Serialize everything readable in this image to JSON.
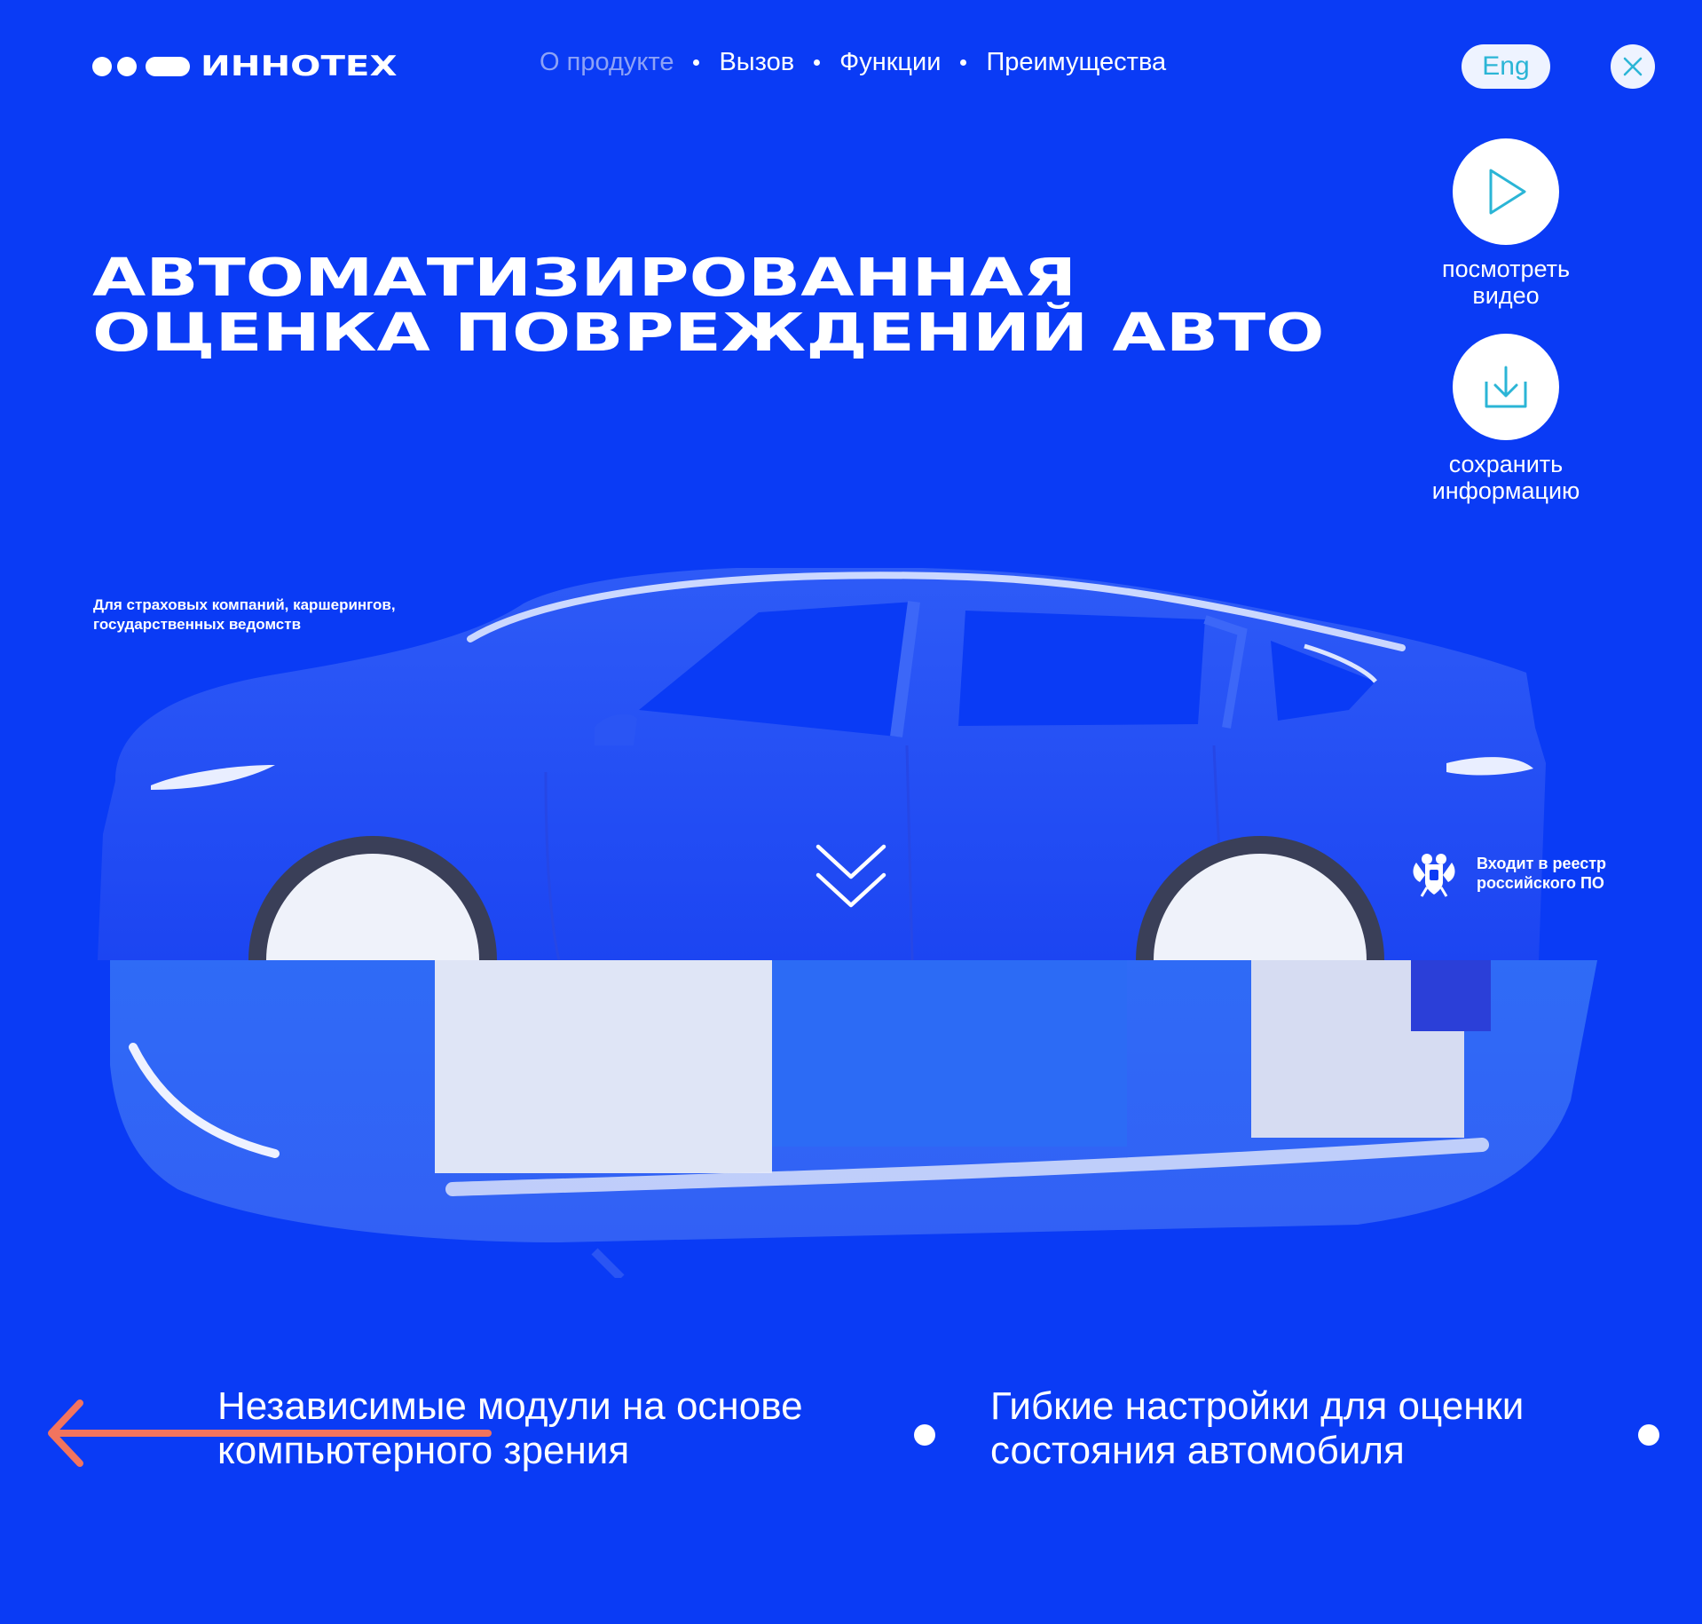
{
  "header": {
    "logo_text": "ИННОТЕХ",
    "nav": [
      {
        "label": "О продукте",
        "active": true
      },
      {
        "label": "Вызов",
        "active": false
      },
      {
        "label": "Функции",
        "active": false
      },
      {
        "label": "Преимущества",
        "active": false
      }
    ],
    "lang_label": "Eng"
  },
  "actions": {
    "video": {
      "line1": "посмотреть",
      "line2": "видео"
    },
    "save": {
      "line1": "сохранить",
      "line2": "информацию"
    }
  },
  "hero": {
    "title_line1": "АВТОМАТИЗИРОВАННАЯ",
    "title_line2": "ОЦЕНКА ПОВРЕЖДЕНИЙ АВТО",
    "audience_line1": "Для страховых компаний, каршерингов,",
    "audience_line2": "государственных ведомств"
  },
  "registry": {
    "line1": "Входит в реестр",
    "line2": "российского ПО"
  },
  "slider": {
    "slides": [
      {
        "line1": "Независимые модули на основе",
        "line2": "компьютерного зрения"
      },
      {
        "line1": "Гибкие настройки для оценки",
        "line2": "состояния автомобиля"
      }
    ]
  },
  "colors": {
    "background": "#0A3BF5",
    "accent_cyan": "#2BB5D6",
    "arrow_coral": "#F2745E",
    "nav_inactive": "#8DA2F6"
  },
  "icons": {
    "play": "play-icon",
    "download": "download-icon",
    "close": "close-icon",
    "scroll": "double-chevron-down-icon",
    "emblem": "coat-of-arms-icon",
    "back": "arrow-left-icon"
  }
}
